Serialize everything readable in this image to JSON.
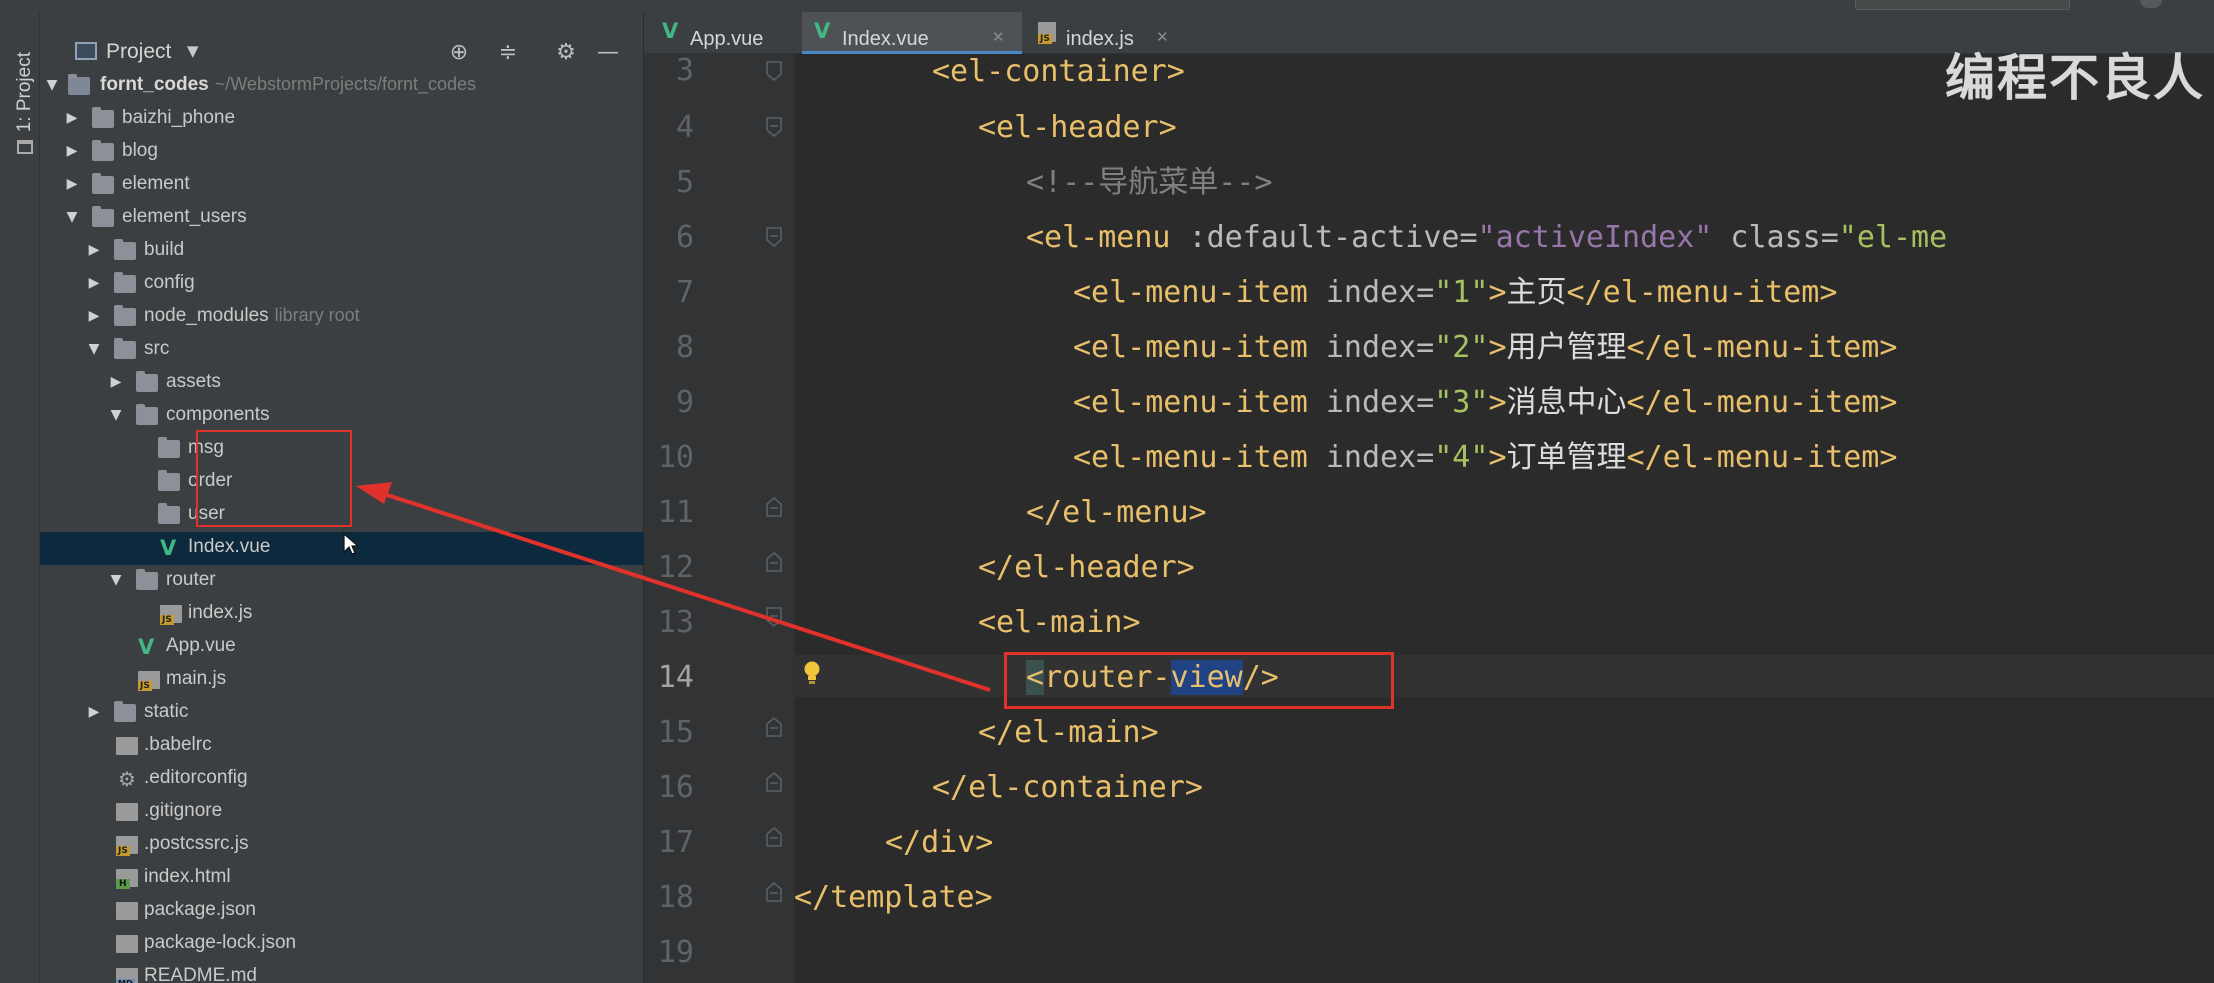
{
  "project_panel": {
    "title": "Project",
    "vertical_tab_label": "1: Project",
    "tree": [
      {
        "label": "fornt_codes",
        "hint": "~/WebstormProjects/fornt_codes",
        "icon": "folder-icon",
        "expanded": true
      },
      {
        "label": "baizhi_phone",
        "icon": "folder-icon",
        "expanded": false
      },
      {
        "label": "blog",
        "icon": "folder-icon",
        "expanded": false
      },
      {
        "label": "element",
        "icon": "folder-icon",
        "expanded": false
      },
      {
        "label": "element_users",
        "icon": "folder-icon",
        "expanded": true
      },
      {
        "label": "build",
        "icon": "folder-icon",
        "expanded": false
      },
      {
        "label": "config",
        "icon": "folder-icon",
        "expanded": false
      },
      {
        "label": "node_modules",
        "hint": "library root",
        "icon": "folder-icon",
        "expanded": false
      },
      {
        "label": "src",
        "icon": "folder-icon",
        "expanded": true
      },
      {
        "label": "assets",
        "icon": "folder-icon",
        "expanded": false
      },
      {
        "label": "components",
        "icon": "folder-icon",
        "expanded": true
      },
      {
        "label": "msg",
        "icon": "folder-icon"
      },
      {
        "label": "order",
        "icon": "folder-icon"
      },
      {
        "label": "user",
        "icon": "folder-icon"
      },
      {
        "label": "Index.vue",
        "icon": "vue-icon",
        "selected": true
      },
      {
        "label": "router",
        "icon": "folder-icon",
        "expanded": true
      },
      {
        "label": "index.js",
        "icon": "js-file-icon"
      },
      {
        "label": "App.vue",
        "icon": "vue-icon"
      },
      {
        "label": "main.js",
        "icon": "js-file-icon"
      },
      {
        "label": "static",
        "icon": "folder-icon",
        "expanded": false
      },
      {
        "label": ".babelrc",
        "icon": "config-file-icon"
      },
      {
        "label": ".editorconfig",
        "icon": "gear-icon"
      },
      {
        "label": ".gitignore",
        "icon": "config-file-icon"
      },
      {
        "label": ".postcssrc.js",
        "icon": "js-file-icon"
      },
      {
        "label": "index.html",
        "icon": "html-file-icon"
      },
      {
        "label": "package.json",
        "icon": "config-file-icon"
      },
      {
        "label": "package-lock.json",
        "icon": "config-file-icon"
      },
      {
        "label": "README.md",
        "icon": "markdown-file-icon"
      }
    ]
  },
  "tabs": [
    {
      "label": "App.vue",
      "icon": "vue-icon",
      "active": false
    },
    {
      "label": "Index.vue",
      "icon": "vue-icon",
      "active": true
    },
    {
      "label": "index.js",
      "icon": "js-file-icon",
      "active": false
    }
  ],
  "editor": {
    "line_numbers": [
      "3",
      "4",
      "5",
      "6",
      "7",
      "8",
      "9",
      "10",
      "11",
      "12",
      "13",
      "14",
      "15",
      "16",
      "17",
      "18",
      "19"
    ],
    "current_line": "14",
    "lines": {
      "l3": {
        "open": "<el-container>"
      },
      "l4": {
        "open": "<el-header>"
      },
      "l5": {
        "comment": "<!--导航菜单-->"
      },
      "l6": {
        "open": "<el-menu",
        "attr1": " :default-active=",
        "val1": "\"activeIndex\"",
        "attr2": " class=",
        "val2": "\"el-me"
      },
      "l7": {
        "open": "<el-menu-item",
        "attr": " index=",
        "val": "\"1\"",
        "gt": ">",
        "text": "主页",
        "close": "</el-menu-item>"
      },
      "l8": {
        "open": "<el-menu-item",
        "attr": " index=",
        "val": "\"2\"",
        "gt": ">",
        "text": "用户管理",
        "close": "</el-menu-item>"
      },
      "l9": {
        "open": "<el-menu-item",
        "attr": " index=",
        "val": "\"3\"",
        "gt": ">",
        "text": "消息中心",
        "close": "</el-menu-item>"
      },
      "l10": {
        "open": "<el-menu-item",
        "attr": " index=",
        "val": "\"4\"",
        "gt": ">",
        "text": "订单管理",
        "close": "</el-menu-item>"
      },
      "l11": {
        "close": "</el-menu>"
      },
      "l12": {
        "close": "</el-header>"
      },
      "l13": {
        "open": "<el-main>"
      },
      "l14": {
        "lt": "<",
        "part1": "router-",
        "part2": "view",
        "end": "/>"
      },
      "l15": {
        "close": "</el-main>"
      },
      "l16": {
        "close": "</el-container>"
      },
      "l17": {
        "close": "</div>"
      },
      "l18": {
        "close": "</template>"
      }
    }
  },
  "watermark": "编程不良人",
  "colors": {
    "annotation_red": "#e0312a",
    "tag": "#e8bf6a",
    "string": "#a5c261",
    "binding": "#9876aa",
    "comment": "#808080",
    "selection": "#0d293e",
    "tab_accent": "#4a88c7"
  }
}
